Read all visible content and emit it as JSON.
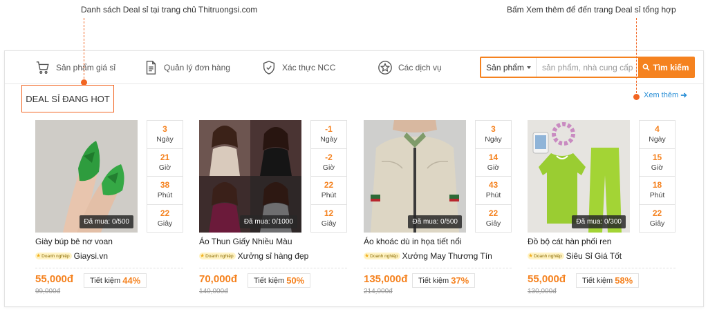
{
  "annotations": {
    "left_note": "Danh sách Deal sỉ tại trang chủ Thitruongsi.com",
    "right_note": "Bấm Xem thêm để đến trang Deal sỉ tổng hợp"
  },
  "nav": {
    "items": [
      {
        "label": "Sản phẩm giá sỉ",
        "icon": "cart-icon"
      },
      {
        "label": "Quản lý đơn hàng",
        "icon": "document-icon"
      },
      {
        "label": "Xác thực NCC",
        "icon": "shield-check-icon"
      },
      {
        "label": "Các dịch vụ",
        "icon": "star-circle-icon"
      }
    ]
  },
  "search": {
    "category": "Sản phẩm",
    "placeholder": "sản phẩm, nhà cung cấp ...",
    "button_label": "Tìm kiếm"
  },
  "section": {
    "title": "DEAL SỈ ĐANG HOT",
    "see_more": "Xem thêm"
  },
  "colors": {
    "accent": "#f5821f",
    "annotation": "#f26522",
    "link": "#2a8fd6"
  },
  "products": [
    {
      "name": "Giày búp bê nơ voan",
      "bought": "Đã mua: 0/500",
      "countdown": [
        {
          "num": "3",
          "unit": "Ngày"
        },
        {
          "num": "21",
          "unit": "Giờ"
        },
        {
          "num": "38",
          "unit": "Phút"
        },
        {
          "num": "22",
          "unit": "Giây"
        }
      ],
      "badge": "Doanh nghiệp",
      "shop": "Giaysi.vn",
      "price": "55,000đ",
      "old_price": "99,000đ",
      "save_label": "Tiết kiệm",
      "save_pct": "44%"
    },
    {
      "name": "Áo Thun Giấy Nhiều Màu",
      "bought": "Đã mua: 0/1000",
      "countdown": [
        {
          "num": "-1",
          "unit": "Ngày"
        },
        {
          "num": "-2",
          "unit": "Giờ"
        },
        {
          "num": "22",
          "unit": "Phút"
        },
        {
          "num": "12",
          "unit": "Giây"
        }
      ],
      "badge": "Doanh nghiệp",
      "shop": "Xưởng sỉ hàng đẹp",
      "price": "70,000đ",
      "old_price": "140,000đ",
      "save_label": "Tiết kiệm",
      "save_pct": "50%"
    },
    {
      "name": "Áo khoác dù in họa tiết nổi",
      "bought": "Đã mua: 0/500",
      "countdown": [
        {
          "num": "3",
          "unit": "Ngày"
        },
        {
          "num": "14",
          "unit": "Giờ"
        },
        {
          "num": "43",
          "unit": "Phút"
        },
        {
          "num": "22",
          "unit": "Giây"
        }
      ],
      "badge": "Doanh nghiệp",
      "shop": "Xưởng May Thương Tín",
      "price": "135,000đ",
      "old_price": "214,000đ",
      "save_label": "Tiết kiệm",
      "save_pct": "37%"
    },
    {
      "name": "Đồ bộ cát hàn phối ren",
      "bought": "Đã mua: 0/300",
      "countdown": [
        {
          "num": "4",
          "unit": "Ngày"
        },
        {
          "num": "15",
          "unit": "Giờ"
        },
        {
          "num": "18",
          "unit": "Phút"
        },
        {
          "num": "22",
          "unit": "Giây"
        }
      ],
      "badge": "Doanh nghiệp",
      "shop": "Siêu Sỉ Giá Tốt",
      "price": "55,000đ",
      "old_price": "130,000đ",
      "save_label": "Tiết kiệm",
      "save_pct": "58%"
    }
  ]
}
